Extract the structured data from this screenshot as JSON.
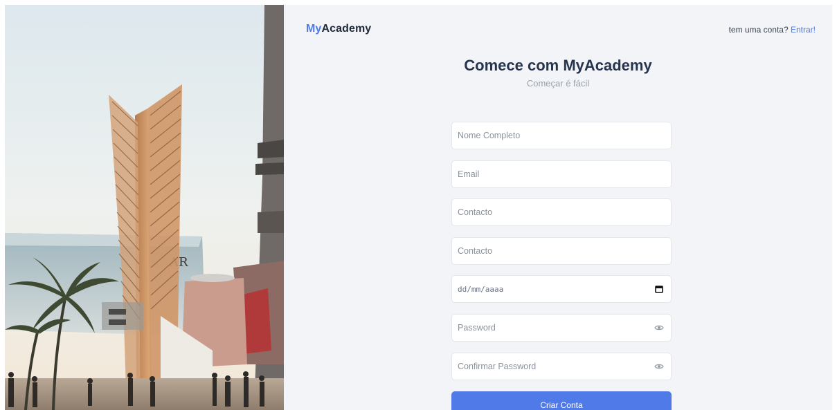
{
  "brand": {
    "accent": "My",
    "rest": "Academy"
  },
  "header": {
    "prompt": "tem uma conta?",
    "login_label": "Entrar!"
  },
  "main": {
    "title": "Comece com MyAcademy",
    "subtitle": "Começar é fácil"
  },
  "form": {
    "full_name_placeholder": "Nome Completo",
    "email_placeholder": "Email",
    "contact_placeholder": "Contacto",
    "contact2_placeholder": "Contacto",
    "date_placeholder": "dd/mm/aaaa",
    "password_placeholder": "Password",
    "confirm_password_placeholder": "Confirmar Password",
    "submit_label": "Criar Conta",
    "icons": {
      "date": "calendar-icon",
      "password": "eye-icon"
    }
  },
  "colors": {
    "accent": "#4f7ae8",
    "panel_background": "#f2f4f7",
    "heading": "#27344f",
    "muted": "#9aa1ab"
  }
}
